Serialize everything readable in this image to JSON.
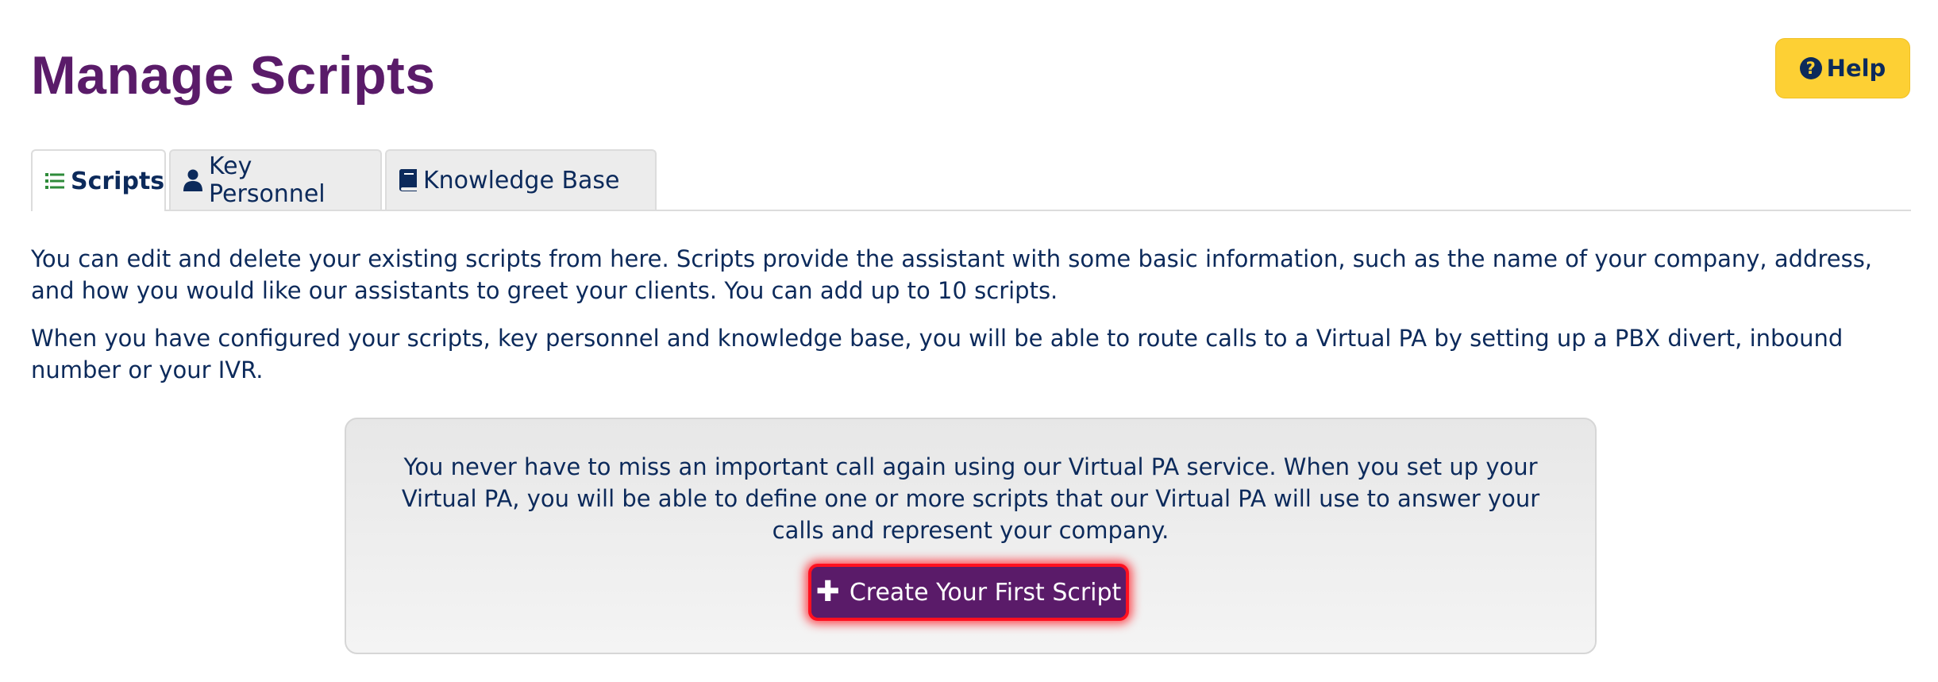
{
  "header": {
    "title": "Manage Scripts",
    "help_label": "Help",
    "help_icon": "question-circle-icon"
  },
  "tabs": [
    {
      "label": "Scripts",
      "icon": "list-icon",
      "active": true,
      "icon_color": "#2e8b3a"
    },
    {
      "label": "Key Personnel",
      "icon": "user-icon",
      "active": false
    },
    {
      "label": "Knowledge Base",
      "icon": "book-icon",
      "active": false
    }
  ],
  "intro": {
    "paragraph_1": "You can edit and delete your existing scripts from here. Scripts provide the assistant with some basic information, such as the name of your company, address, and how you would like our assistants to greet your clients. You can add up to 10 scripts.",
    "paragraph_2": "When you have configured your scripts, key personnel and knowledge base, you will be able to route calls to a Virtual PA by setting up a PBX divert, inbound number or your IVR."
  },
  "empty_state": {
    "message": "You never have to miss an important call again using our Virtual PA service. When you set up your Virtual PA, you will be able to define one or more scripts that our Virtual PA will use to answer your calls and represent your company.",
    "button_label": "Create Your First Script",
    "button_icon": "plus-icon"
  },
  "colors": {
    "brand_purple": "#5a1b69",
    "help_yellow": "#fdd034",
    "text_navy": "#0c2a5b",
    "highlight_red": "#ff1020"
  }
}
